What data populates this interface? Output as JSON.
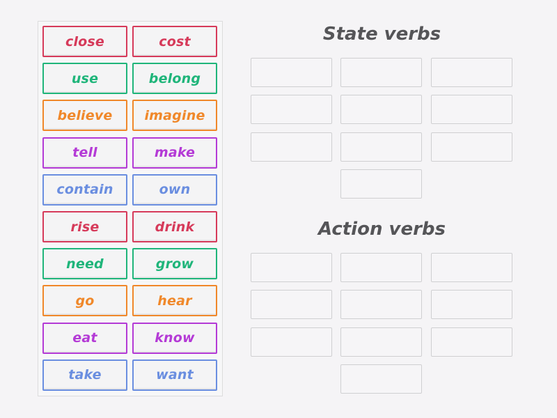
{
  "colors": {
    "red": "#d63a5a",
    "green": "#1fb57a",
    "orange": "#f0882a",
    "purple": "#b43ad6",
    "blue": "#6a8ee0"
  },
  "word_bank": [
    {
      "label": "close",
      "color": "red"
    },
    {
      "label": "cost",
      "color": "red"
    },
    {
      "label": "use",
      "color": "green"
    },
    {
      "label": "belong",
      "color": "green"
    },
    {
      "label": "believe",
      "color": "orange"
    },
    {
      "label": "imagine",
      "color": "orange"
    },
    {
      "label": "tell",
      "color": "purple"
    },
    {
      "label": "make",
      "color": "purple"
    },
    {
      "label": "contain",
      "color": "blue"
    },
    {
      "label": "own",
      "color": "blue"
    },
    {
      "label": "rise",
      "color": "red"
    },
    {
      "label": "drink",
      "color": "red"
    },
    {
      "label": "need",
      "color": "green"
    },
    {
      "label": "grow",
      "color": "green"
    },
    {
      "label": "go",
      "color": "orange"
    },
    {
      "label": "hear",
      "color": "orange"
    },
    {
      "label": "eat",
      "color": "purple"
    },
    {
      "label": "know",
      "color": "purple"
    },
    {
      "label": "take",
      "color": "blue"
    },
    {
      "label": "want",
      "color": "blue"
    }
  ],
  "groups": [
    {
      "title": "State verbs",
      "slot_count": 10
    },
    {
      "title": "Action verbs",
      "slot_count": 10
    }
  ]
}
